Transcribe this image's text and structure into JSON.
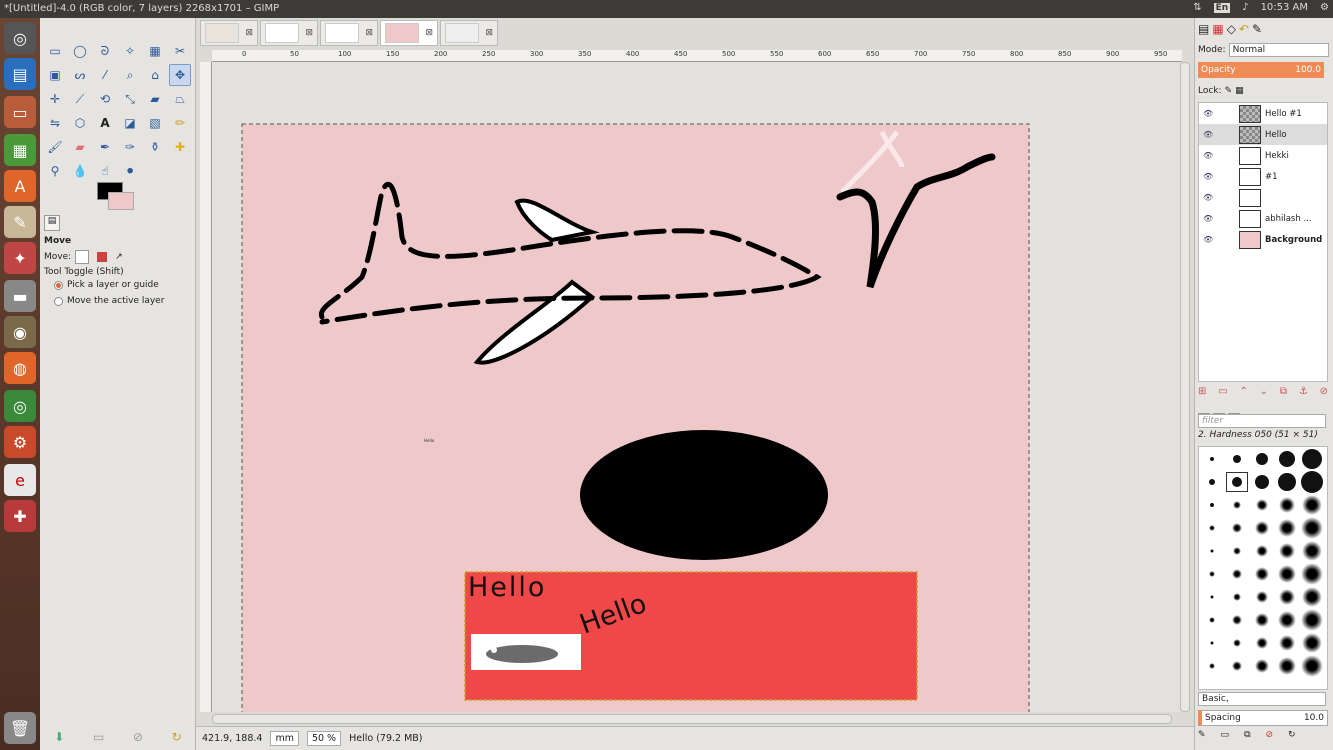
{
  "window": {
    "title": "*[Untitled]-4.0 (RGB color, 7 layers) 2268x1701 – GIMP"
  },
  "tray": {
    "lang": "En",
    "time": "10:53 AM"
  },
  "tool_options": {
    "title": "Move",
    "move_label": "Move:",
    "toggle": "Tool Toggle  (Shift)",
    "opt1": "Pick a layer or guide",
    "opt2": "Move the active layer"
  },
  "ruler": {
    "ticks": [
      "0",
      "50",
      "100",
      "150",
      "200",
      "250",
      "300",
      "350",
      "400",
      "450",
      "500",
      "550",
      "600",
      "650",
      "700",
      "750",
      "800",
      "850",
      "900",
      "950"
    ]
  },
  "canvas": {
    "text1": "Hello",
    "text2": "Hello",
    "tiny": "Hello"
  },
  "status": {
    "coords": "421.9, 188.4",
    "unit": "mm",
    "zoom": "50 %",
    "info": "Hello (79.2 MB)"
  },
  "layers_panel": {
    "mode_label": "Mode:",
    "mode": "Normal",
    "opacity_label": "Opacity",
    "opacity": "100.0",
    "lock_label": "Lock:",
    "layers": [
      {
        "name": "Hello #1",
        "bold": false
      },
      {
        "name": "Hello",
        "bold": false
      },
      {
        "name": "Hekki",
        "bold": false
      },
      {
        "name": "#1",
        "bold": false
      },
      {
        "name": "",
        "bold": false
      },
      {
        "name": "abhilash ...",
        "bold": false
      },
      {
        "name": "Background",
        "bold": true
      }
    ]
  },
  "brushes_panel": {
    "filter_placeholder": "filter",
    "brush_name": "2. Hardness 050 (51 × 51)",
    "preset": "Basic,",
    "spacing_label": "Spacing",
    "spacing": "10.0"
  },
  "colors": {
    "fg": "#000000",
    "bg": "#efc9c9",
    "canvas": "#efc9c9",
    "text_layer": "#f04848"
  }
}
